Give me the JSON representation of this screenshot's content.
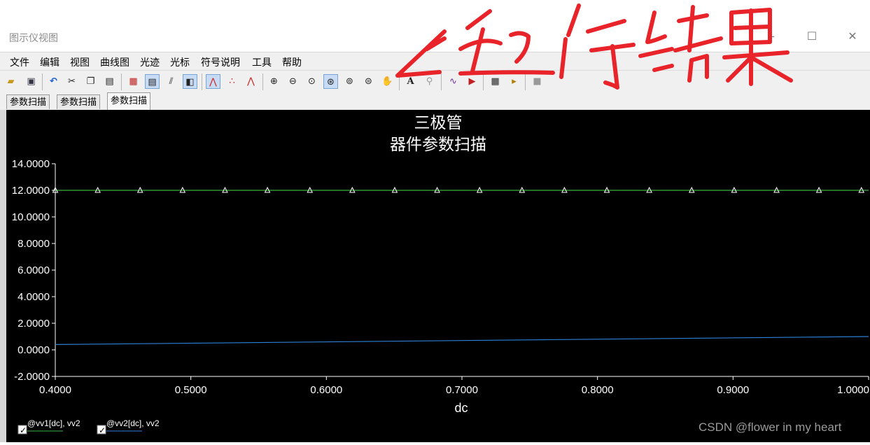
{
  "window": {
    "title": "图示仪视图"
  },
  "menu": [
    "文件",
    "编辑",
    "视图",
    "曲线图",
    "光迹",
    "光标",
    "符号说明",
    "工具",
    "帮助"
  ],
  "tabs": [
    "参数扫描",
    "参数扫描",
    "参数扫描"
  ],
  "annotation": "运行结果",
  "watermark": "CSDN @flower in my heart",
  "chart_data": {
    "type": "line",
    "title": "三极管",
    "subtitle": "器件参数扫描",
    "xlabel": "dc",
    "ylabel": "",
    "xlim": [
      0.4,
      1.0
    ],
    "ylim": [
      -2.0,
      14.0
    ],
    "x_ticks": [
      "0.4000",
      "0.5000",
      "0.6000",
      "0.7000",
      "0.8000",
      "0.9000",
      "1.0000"
    ],
    "y_ticks": [
      "14.0000",
      "12.0000",
      "10.0000",
      "8.0000",
      "6.0000",
      "4.0000",
      "2.0000",
      "0.0000",
      "-2.0000"
    ],
    "grid": false,
    "legend_position": "bottom-left",
    "series": [
      {
        "name": "@vv1[dc], vv2",
        "color": "#3cb043",
        "marker": "triangle",
        "x": [
          0.4,
          1.0
        ],
        "y": [
          12.0,
          12.0
        ],
        "marker_x": [
          0.4,
          0.4313,
          0.4626,
          0.4939,
          0.5252,
          0.5565,
          0.5878,
          0.6191,
          0.6504,
          0.6817,
          0.713,
          0.7443,
          0.7756,
          0.8069,
          0.8382,
          0.8695,
          0.9008,
          0.9321,
          0.9634,
          0.9947
        ]
      },
      {
        "name": "@vv2[dc], vv2",
        "color": "#2f7fd6",
        "x": [
          0.4,
          1.0
        ],
        "y": [
          0.4,
          1.0
        ]
      }
    ]
  }
}
